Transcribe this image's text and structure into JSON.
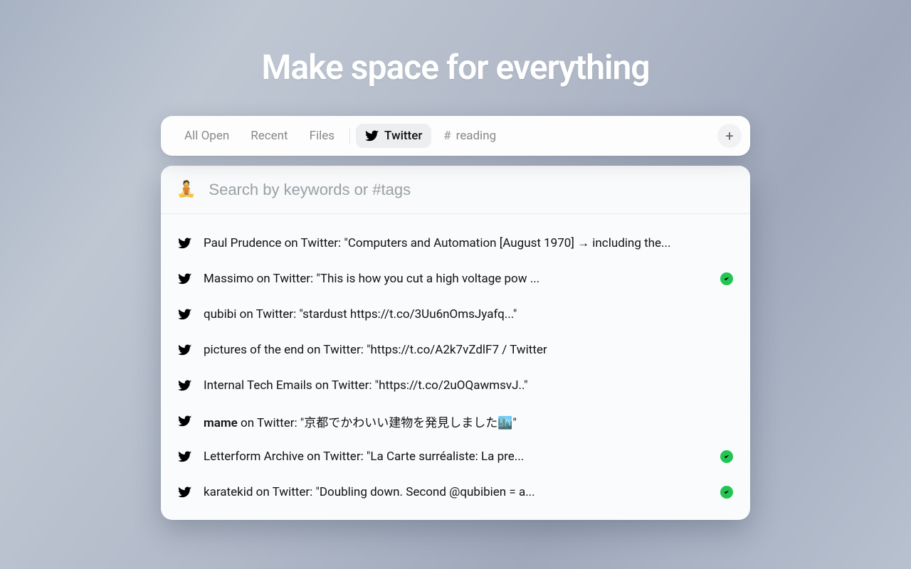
{
  "hero": {
    "title": "Make space for everything"
  },
  "tabs": {
    "items": [
      {
        "label": "All Open",
        "icon": null,
        "active": false
      },
      {
        "label": "Recent",
        "icon": null,
        "active": false
      },
      {
        "label": "Files",
        "icon": null,
        "active": false
      },
      {
        "label": "Twitter",
        "icon": "twitter",
        "active": true
      },
      {
        "label": "reading",
        "icon": "hash",
        "active": false
      }
    ],
    "separator_after_index": 2,
    "add_tooltip": "Add"
  },
  "search": {
    "icon": "🧘",
    "placeholder": "Search by keywords or #tags",
    "value": ""
  },
  "results": [
    {
      "author": "Paul Prudence",
      "bold": false,
      "rest": " on Twitter: \"Computers and Automation [August 1970] → including the...",
      "checked": false
    },
    {
      "author": "Massimo",
      "bold": false,
      "rest": " on Twitter: \"This is how you cut a high voltage pow ...",
      "checked": true
    },
    {
      "author": "qubibi",
      "bold": false,
      "rest": " on Twitter: \"stardust https://t.co/3Uu6nOmsJyafq...\"",
      "checked": false
    },
    {
      "author": "pictures of the end",
      "bold": false,
      "rest": " on Twitter: \"https://t.co/A2k7vZdlF7 / Twitter",
      "checked": false
    },
    {
      "author": "Internal Tech Emails",
      "bold": false,
      "rest": " on Twitter: \"https://t.co/2uOQawmsvJ..\"",
      "checked": false
    },
    {
      "author": "mame",
      "bold": true,
      "rest": " on Twitter: \"京都でかわいい建物を発見しました🏙️\"",
      "checked": false
    },
    {
      "author": "Letterform Archive",
      "bold": false,
      "rest": " on Twitter: \"La Carte surréaliste: La pre...",
      "checked": true
    },
    {
      "author": "karatekid",
      "bold": false,
      "rest": " on Twitter: \"Doubling down. Second @qubibien = a...",
      "checked": true
    }
  ]
}
